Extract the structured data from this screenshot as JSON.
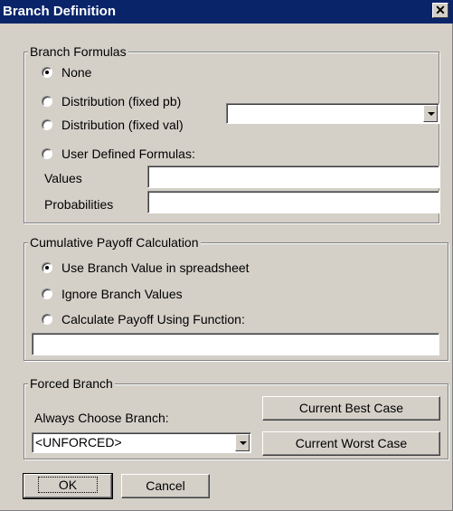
{
  "window": {
    "title": "Branch Definition",
    "close_label": "✕"
  },
  "branch_formulas": {
    "group_label": "Branch Formulas",
    "options": [
      {
        "label": "None",
        "checked": true
      },
      {
        "label": "Distribution (fixed pb)",
        "checked": false
      },
      {
        "label": "Distribution (fixed val)",
        "checked": false
      },
      {
        "label": "User Defined Formulas:",
        "checked": false
      }
    ],
    "distribution_combo_value": "",
    "values_label": "Values",
    "values_value": "",
    "probabilities_label": "Probabilities",
    "probabilities_value": ""
  },
  "cumulative_payoff": {
    "group_label": "Cumulative Payoff Calculation",
    "options": [
      {
        "label": "Use Branch Value in spreadsheet",
        "checked": true
      },
      {
        "label": "Ignore Branch Values",
        "checked": false
      },
      {
        "label": "Calculate Payoff Using Function:",
        "checked": false
      }
    ],
    "function_value": ""
  },
  "forced_branch": {
    "group_label": "Forced Branch",
    "always_choose_label": "Always Choose Branch:",
    "combo_value": "<UNFORCED>",
    "best_case_label": "Current Best Case",
    "worst_case_label": "Current Worst Case"
  },
  "buttons": {
    "ok": "OK",
    "cancel": "Cancel"
  }
}
